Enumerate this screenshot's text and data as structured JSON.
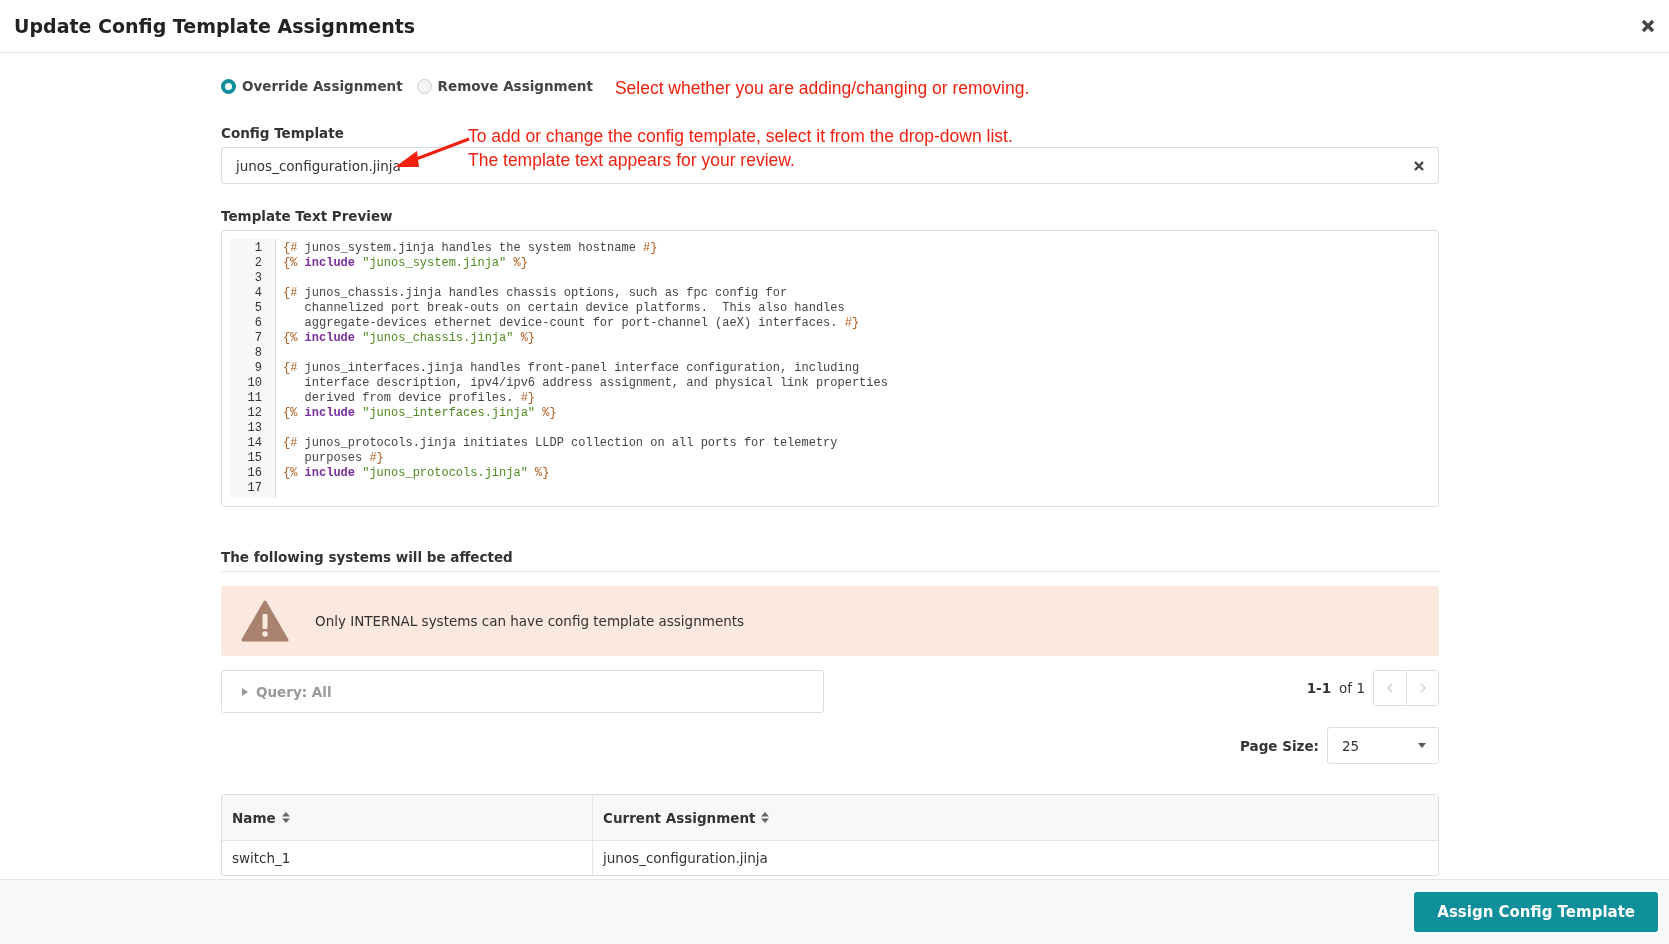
{
  "window": {
    "title": "Update Config Template Assignments"
  },
  "mode_options": [
    {
      "label": "Override Assignment",
      "selected": true
    },
    {
      "label": "Remove Assignment",
      "selected": false
    }
  ],
  "annotations": [
    {
      "lines": [
        "Select whether you are adding/changing or removing."
      ]
    },
    {
      "lines": [
        "To add or change the config template, select it from the drop-down list.",
        "The template text appears for your review."
      ]
    }
  ],
  "config_template": {
    "label": "Config Template",
    "value": "junos_configuration.jinja"
  },
  "preview": {
    "label": "Template Text Preview",
    "lines": [
      {
        "number": "1",
        "tokens": [
          {
            "kind": "delim",
            "text": "{#"
          },
          {
            "kind": "plain",
            "text": " junos_system.jinja handles the system hostname "
          },
          {
            "kind": "delim",
            "text": "#}"
          }
        ]
      },
      {
        "number": "2",
        "tokens": [
          {
            "kind": "delim",
            "text": "{%"
          },
          {
            "kind": "keyword",
            "text": " include "
          },
          {
            "kind": "string",
            "text": "\"junos_system.jinja\""
          },
          {
            "kind": "delim",
            "text": " %}"
          }
        ]
      },
      {
        "number": "3"
      },
      {
        "number": "4",
        "tokens": [
          {
            "kind": "delim",
            "text": "{#"
          },
          {
            "kind": "plain",
            "text": " junos_chassis.jinja handles chassis options, such as fpc config for"
          }
        ]
      },
      {
        "number": "5",
        "tokens": [
          {
            "kind": "plain",
            "text": "   channelized port break-outs on certain device platforms.  This also handles"
          }
        ]
      },
      {
        "number": "6",
        "tokens": [
          {
            "kind": "plain",
            "text": "   aggregate-devices ethernet device-count for port-channel (aeX) interfaces. "
          },
          {
            "kind": "delim",
            "text": "#}"
          }
        ]
      },
      {
        "number": "7",
        "tokens": [
          {
            "kind": "delim",
            "text": "{%"
          },
          {
            "kind": "keyword",
            "text": " include "
          },
          {
            "kind": "string",
            "text": "\"junos_chassis.jinja\""
          },
          {
            "kind": "delim",
            "text": " %}"
          }
        ]
      },
      {
        "number": "8"
      },
      {
        "number": "9",
        "tokens": [
          {
            "kind": "delim",
            "text": "{#"
          },
          {
            "kind": "plain",
            "text": " junos_interfaces.jinja handles front-panel interface configuration, including"
          }
        ]
      },
      {
        "number": "10",
        "tokens": [
          {
            "kind": "plain",
            "text": "   interface description, ipv4/ipv6 address assignment, and physical link properties"
          }
        ]
      },
      {
        "number": "11",
        "tokens": [
          {
            "kind": "plain",
            "text": "   derived from device profiles. "
          },
          {
            "kind": "delim",
            "text": "#}"
          }
        ]
      },
      {
        "number": "12",
        "tokens": [
          {
            "kind": "delim",
            "text": "{%"
          },
          {
            "kind": "keyword",
            "text": " include "
          },
          {
            "kind": "string",
            "text": "\"junos_interfaces.jinja\""
          },
          {
            "kind": "delim",
            "text": " %}"
          }
        ]
      },
      {
        "number": "13"
      },
      {
        "number": "14",
        "tokens": [
          {
            "kind": "delim",
            "text": "{#"
          },
          {
            "kind": "plain",
            "text": " junos_protocols.jinja initiates LLDP collection on all ports for telemetry"
          }
        ]
      },
      {
        "number": "15",
        "tokens": [
          {
            "kind": "plain",
            "text": "   purposes "
          },
          {
            "kind": "delim",
            "text": "#}"
          }
        ]
      },
      {
        "number": "16",
        "tokens": [
          {
            "kind": "delim",
            "text": "{%"
          },
          {
            "kind": "keyword",
            "text": " include "
          },
          {
            "kind": "string",
            "text": "\"junos_protocols.jinja\""
          },
          {
            "kind": "delim",
            "text": " %}"
          }
        ]
      },
      {
        "number": "17"
      }
    ]
  },
  "affected": {
    "heading": "The following systems will be affected",
    "warning": "Only INTERNAL systems can have config template assignments",
    "query": "Query: All",
    "range": "1-1",
    "of": "of 1",
    "page_size_label": "Page Size:",
    "page_size": "25",
    "table": {
      "columns": [
        "Name",
        "Current Assignment"
      ],
      "rows": [
        [
          "switch_1",
          "junos_configuration.jinja"
        ]
      ]
    }
  },
  "footer": {
    "button": "Assign Config Template"
  }
}
